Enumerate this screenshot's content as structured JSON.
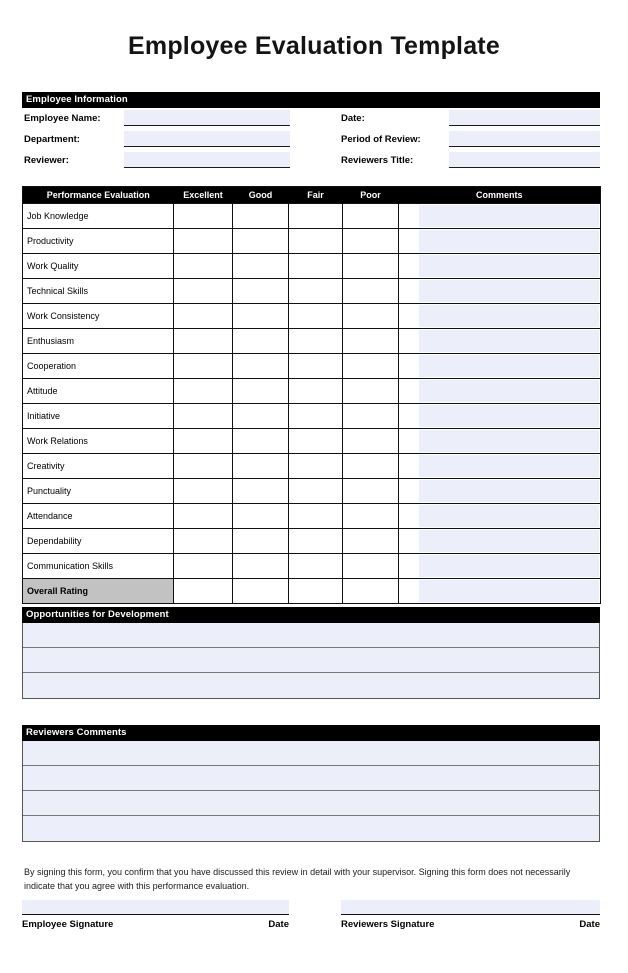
{
  "document": {
    "title": "Employee Evaluation Template"
  },
  "employee_information": {
    "section_title": "Employee Information",
    "rows": [
      {
        "left_label": "Employee Name:",
        "left_value": "",
        "right_label": "Date:",
        "right_value": ""
      },
      {
        "left_label": "Department:",
        "left_value": "",
        "right_label": "Period of Review:",
        "right_value": ""
      },
      {
        "left_label": "Reviewer:",
        "left_value": "",
        "right_label": "Reviewers Title:",
        "right_value": ""
      }
    ]
  },
  "performance_evaluation": {
    "columns": [
      "Performance Evaluation",
      "Excellent",
      "Good",
      "Fair",
      "Poor",
      "Comments"
    ],
    "criteria": [
      "Job Knowledge",
      "Productivity",
      "Work Quality",
      "Technical Skills",
      "Work Consistency",
      "Enthusiasm",
      "Cooperation",
      "Attitude",
      "Initiative",
      "Work Relations",
      "Creativity",
      "Punctuality",
      "Attendance",
      "Dependability",
      "Communication Skills"
    ],
    "overall_row_label": "Overall Rating"
  },
  "opportunities": {
    "section_title": "Opportunities for Development",
    "line_count": 3,
    "lines": [
      "",
      "",
      ""
    ]
  },
  "reviewers_comments": {
    "section_title": "Reviewers Comments",
    "line_count": 4,
    "lines": [
      "",
      "",
      "",
      ""
    ]
  },
  "disclaimer": {
    "text": "By signing this form, you confirm that you have discussed this review in detail with your supervisor. Signing this form does not necessarily indicate that you agree with this performance evaluation."
  },
  "signatures": {
    "employee": {
      "name_label": "Employee Signature",
      "date_label": "Date",
      "value": ""
    },
    "reviewer": {
      "name_label": "Reviewers Signature",
      "date_label": "Date",
      "value": ""
    }
  },
  "colors": {
    "bar_background": "#000000",
    "bar_text": "#ffffff",
    "field_fill": "#eceffa",
    "overall_rating_fill": "#c2c2c2",
    "border_dark": "#111111",
    "border_gray": "#777777"
  }
}
